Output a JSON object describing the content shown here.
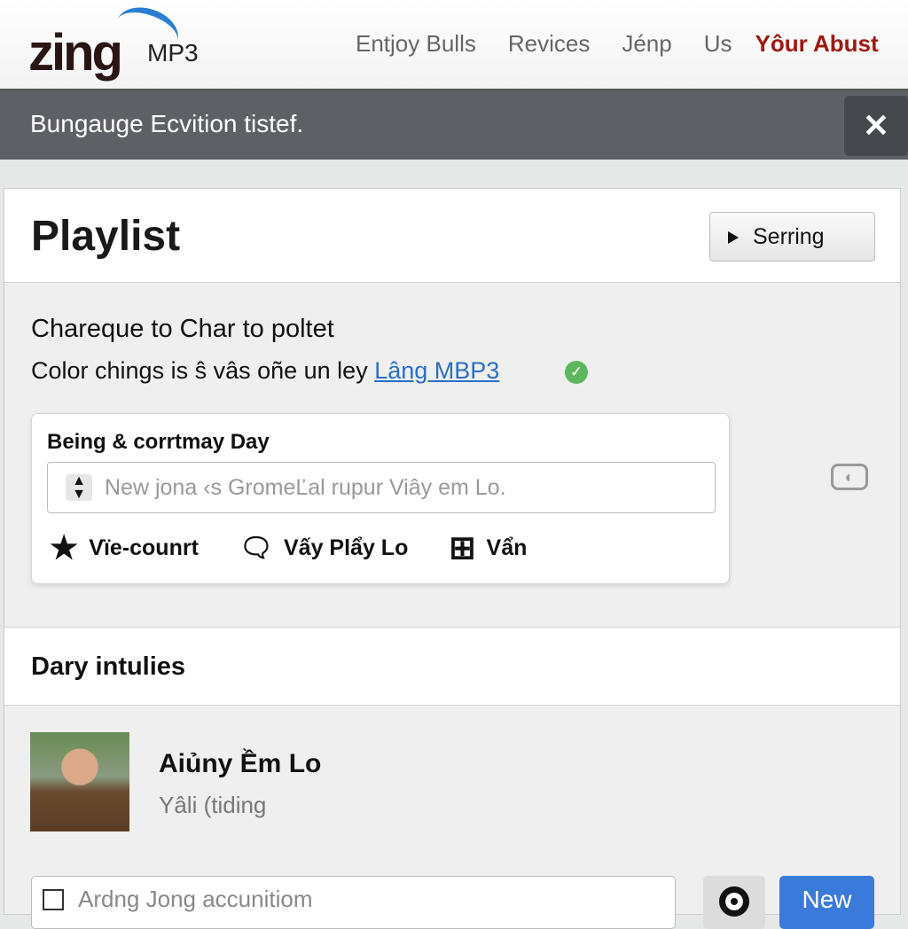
{
  "header": {
    "logo_text": "zing",
    "logo_suffix": "MP3",
    "nav": [
      "Entjoy Bulls",
      "Revices",
      "Jénp",
      "Us"
    ],
    "nav_active": "Yôur Abust"
  },
  "banner": {
    "text": "Bungauge Ecvition tistef.",
    "close": "✕"
  },
  "playlist": {
    "title": "Playlist",
    "button_label": "Serring"
  },
  "info": {
    "line1": "Chareque to Char to poltet",
    "line2": "Color chings is ŝ vâs oñe un ley",
    "link": "Lâng MBP3"
  },
  "card": {
    "title": "Being & corrtmay Day",
    "input_placeholder": "New jona ‹s GromeĽal rupur Viây em Lo.",
    "actions": [
      {
        "icon": "star-icon",
        "glyph": "★",
        "label": "Vïe-counrt"
      },
      {
        "icon": "message-icon",
        "glyph": "🗨",
        "label": "Vấy Plẩy Lo"
      },
      {
        "icon": "windows-icon",
        "glyph": "⊞",
        "label": "Vẩn"
      }
    ]
  },
  "daily": {
    "title": "Dary intulies",
    "user_name": "Aiủny Ềm Lo",
    "user_sub": "Yâli (tiding"
  },
  "bottom": {
    "input_placeholder": "Ardng Jong accunitiom",
    "new_button": "New"
  },
  "colors": {
    "accent": "#3a7ad8",
    "nav_active": "#a0170f",
    "banner": "#5d6166",
    "check": "#5cb85c"
  }
}
